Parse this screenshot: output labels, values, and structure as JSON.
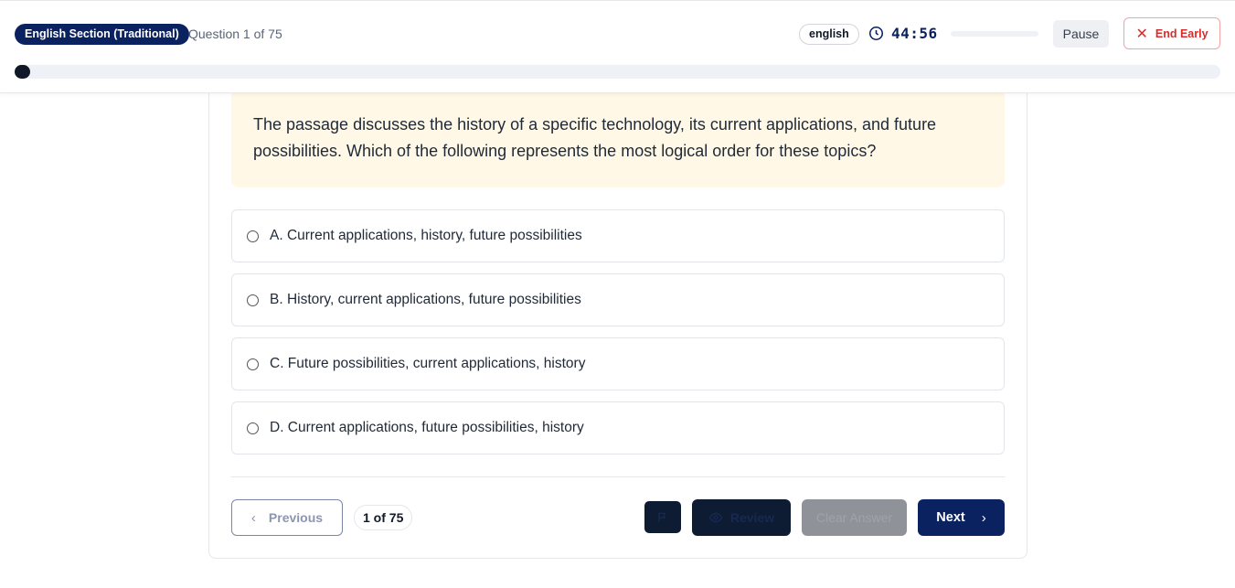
{
  "header": {
    "section_label": "English Section (Traditional)",
    "question_counter": "Question 1 of 75",
    "language": "english",
    "timer": "44:56",
    "timer_progress": 0.0,
    "pause_label": "Pause",
    "end_label": "End Early",
    "progress_fraction": 0.013
  },
  "question": {
    "text": "The passage discusses the history of a specific technology, its current applications, and future possibilities. Which of the following represents the most logical order for these topics?"
  },
  "options": [
    {
      "label": "A. Current applications, history, future possibilities"
    },
    {
      "label": "B. History, current applications, future possibilities"
    },
    {
      "label": "C. Future possibilities, current applications, history"
    },
    {
      "label": "D. Current applications, future possibilities, history"
    }
  ],
  "footer": {
    "previous_label": "Previous",
    "page_indicator": "1 of 75",
    "review_label": "Review",
    "clear_label": "Clear Answer",
    "next_label": "Next"
  },
  "colors": {
    "primary": "#0b2260",
    "danger": "#d72c2c",
    "question_bg": "#fff8e6"
  },
  "icons": [
    "clock-icon",
    "close-icon",
    "chevron-left-icon",
    "flag-icon",
    "eye-icon",
    "chevron-right-icon"
  ]
}
